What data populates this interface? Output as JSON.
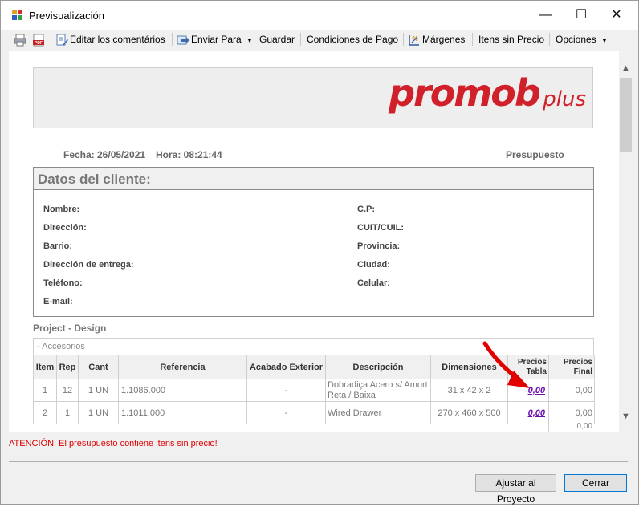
{
  "window": {
    "title": "Previsualización"
  },
  "toolbar": {
    "edit_comments": "Editar los comentários",
    "send_to": "Enviar Para",
    "save": "Guardar",
    "payment_terms": "Condiciones de Pago",
    "margins": "Márgenes",
    "items_no_price": "Itens sin Precio",
    "options": "Opciones"
  },
  "report": {
    "logo_main": "promob",
    "logo_sub": "plus",
    "date": "Fecha: 26/05/2021",
    "time": "Hora: 08:21:44",
    "doc_type": "Presupuesto",
    "client_title": "Datos del cliente:",
    "client_fields_left": [
      "Nombre:",
      "Dirección:",
      "Barrio:",
      "Dirección de entrega:",
      "Teléfono:",
      "E-mail:"
    ],
    "client_fields_right": [
      "C.P:",
      "CUIT/CUIL:",
      "Provincia:",
      "Ciudad:",
      "Celular:"
    ],
    "project": "Project - Design",
    "group": "- Accesorios",
    "columns": [
      "Item",
      "Rep",
      "Cant",
      "Referencia",
      "Acabado Exterior",
      "Descripción",
      "Dimensiones",
      "Precios Tabla",
      "Precios Final"
    ],
    "rows": [
      {
        "item": "1",
        "rep": "12",
        "cant": "1 UN",
        "ref": "1.1086.000",
        "finish": "-",
        "desc": "Dobradiça Acero s/ Amort. Reta / Baixa",
        "dims": "31 x 42 x 2",
        "price_table": "0,00",
        "price_final": "0,00"
      },
      {
        "item": "2",
        "rep": "1",
        "cant": "1 UN",
        "ref": "1.1011.000",
        "finish": "-",
        "desc": "Wired Drawer",
        "dims": "270 x 460 x 500",
        "price_table": "0,00",
        "price_final": "0,00"
      }
    ],
    "total": "0,00"
  },
  "warning": "ATENCIÓN: El presupuesto contiene itens sin precio!",
  "buttons": {
    "adjust": "Ajustar al Proyecto",
    "close": "Cerrar"
  },
  "colors": {
    "logo_red": "#d0202a",
    "warning_red": "#e00000",
    "price_link": "#6a0dad",
    "annotation_arrow": "#e00000"
  }
}
